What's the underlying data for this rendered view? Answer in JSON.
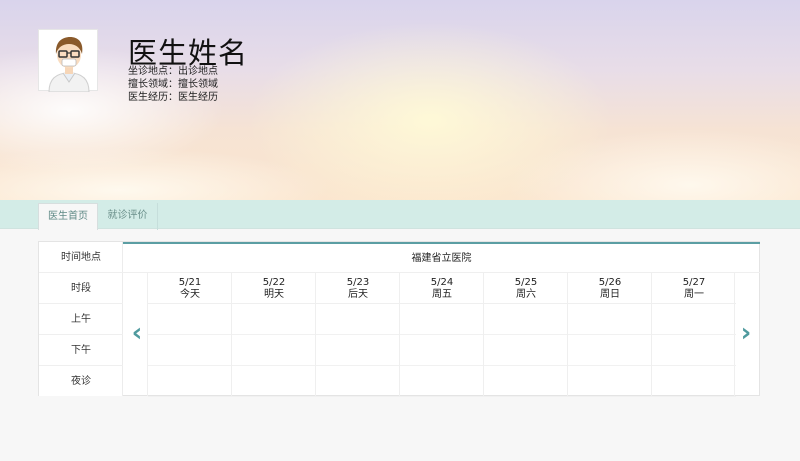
{
  "doctor": {
    "name": "医生姓名",
    "location_line": "坐诊地点：出诊地点",
    "specialty_line": "擅长领域：擅长领域",
    "experience_line": "医生经历：医生经历"
  },
  "tabs": [
    {
      "label": "医生首页",
      "active": true
    },
    {
      "label": "就诊评价",
      "active": false
    }
  ],
  "schedule": {
    "header_label": "时间地点",
    "hospital": "福建省立医院",
    "period_header": "时段",
    "periods": [
      "上午",
      "下午",
      "夜诊"
    ],
    "days": [
      {
        "date": "5/21",
        "day": "今天"
      },
      {
        "date": "5/22",
        "day": "明天"
      },
      {
        "date": "5/23",
        "day": "后天"
      },
      {
        "date": "5/24",
        "day": "周五"
      },
      {
        "date": "5/25",
        "day": "周六"
      },
      {
        "date": "5/26",
        "day": "周日"
      },
      {
        "date": "5/27",
        "day": "周一"
      }
    ],
    "prev_arrow": "‹",
    "next_arrow": "›"
  },
  "icons": {
    "avatar": "doctor-avatar-icon",
    "prev": "chevron-left-icon",
    "next": "chevron-right-icon"
  },
  "colors": {
    "accent": "#5b9ea3",
    "tabbar": "#d3ece7",
    "arrow": "#4f9a9e"
  }
}
